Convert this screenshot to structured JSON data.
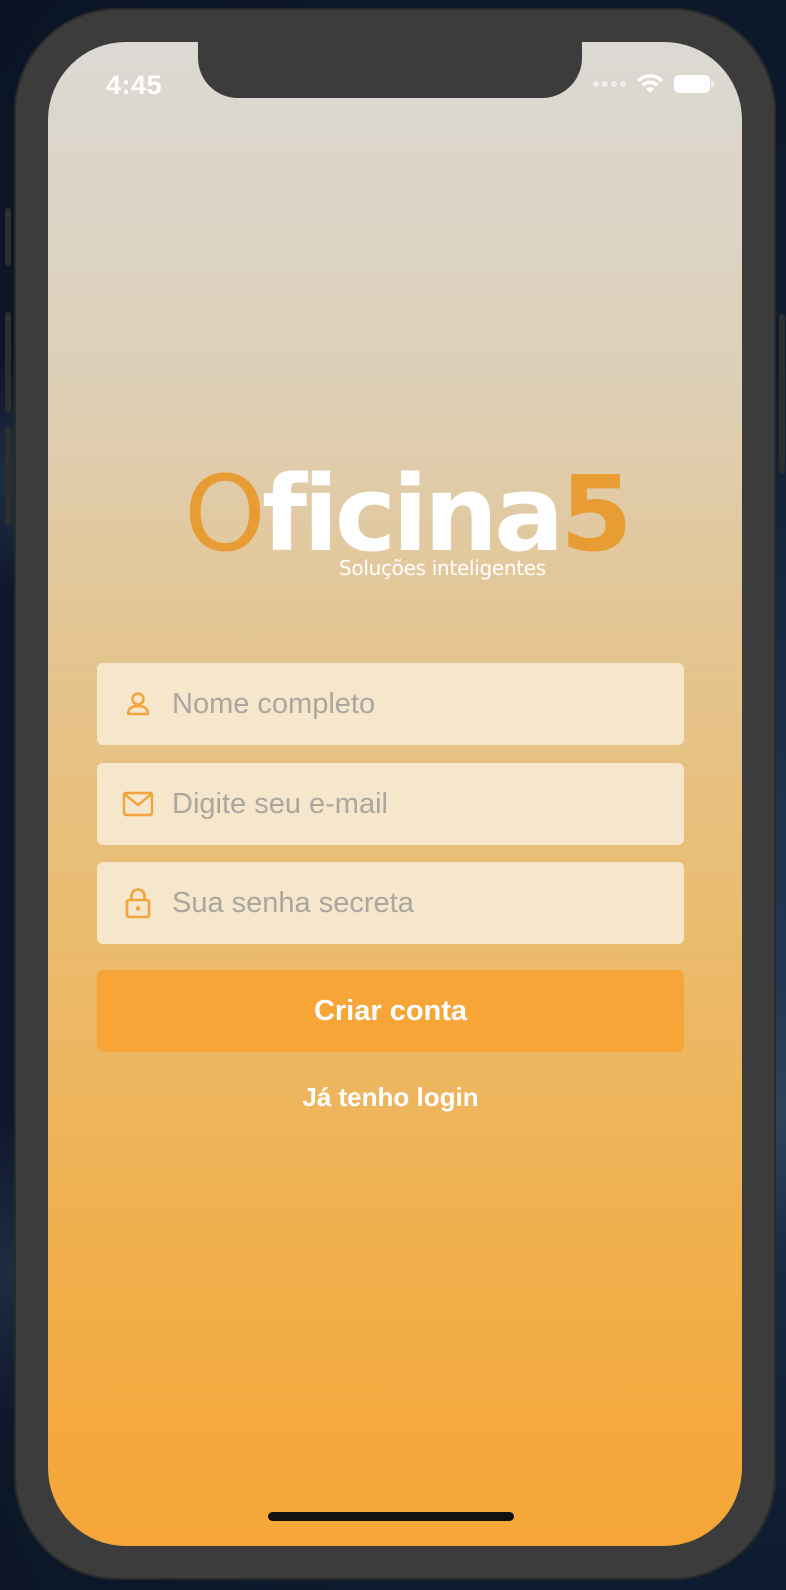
{
  "status_bar": {
    "time": "4:45"
  },
  "logo": {
    "first_letter": "O",
    "word": "ficina",
    "number": "5",
    "tagline": "Soluções inteligentes"
  },
  "form": {
    "name_placeholder": "Nome completo",
    "email_placeholder": "Digite seu e-mail",
    "password_placeholder": "Sua senha secreta",
    "submit_label": "Criar conta",
    "login_link": "Já tenho login"
  },
  "icons": {
    "name": "user-icon",
    "email": "mail-icon",
    "password": "lock-icon"
  },
  "colors": {
    "accent": "#f6a536",
    "logo_orange": "#e79d33",
    "field_background": "#f5e6cc",
    "gradient_top": "#dcd9d4",
    "gradient_bottom": "#f6a638"
  }
}
